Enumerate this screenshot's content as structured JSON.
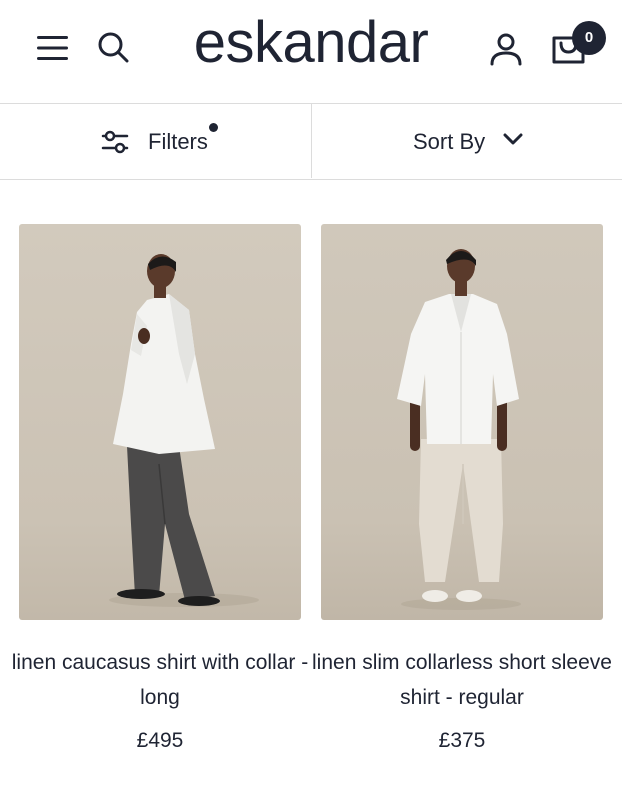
{
  "header": {
    "logo_text": "eskandar",
    "cart_count": "0",
    "icons": [
      "menu-icon",
      "search-icon",
      "account-icon",
      "cart-icon"
    ]
  },
  "toolbar": {
    "filters_label": "Filters",
    "sort_label": "Sort By",
    "icons": [
      "filter-sliders-icon",
      "chevron-down-icon"
    ]
  },
  "products": [
    {
      "title": "linen caucasus shirt with collar - long",
      "price": "£495"
    },
    {
      "title": "linen slim collarless short sleeve shirt - regular",
      "price": "£375"
    }
  ],
  "colors": {
    "ink": "#1f2433",
    "divider": "#dcdcdc",
    "photo_background": "#cdc5b8"
  }
}
